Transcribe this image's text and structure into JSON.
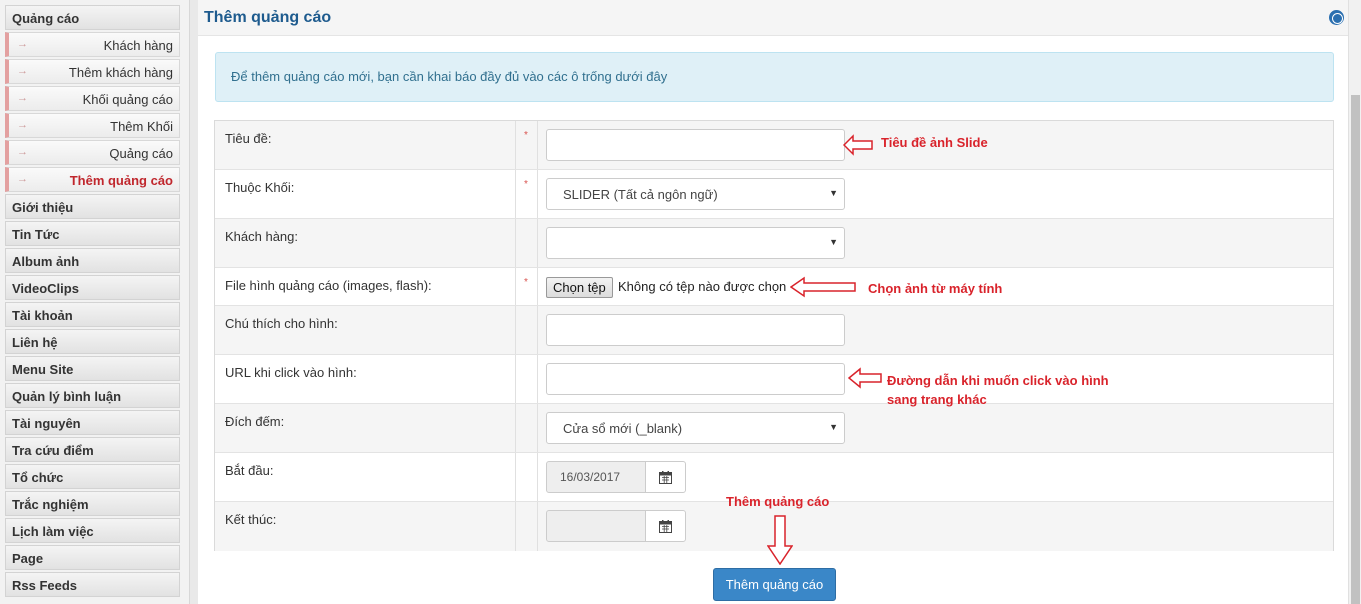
{
  "sidebar": {
    "top_item": "Quảng cáo",
    "sub_items": [
      {
        "label": "Khách hàng",
        "active": false
      },
      {
        "label": "Thêm khách hàng",
        "active": false
      },
      {
        "label": "Khối quảng cáo",
        "active": false
      },
      {
        "label": "Thêm Khối",
        "active": false
      },
      {
        "label": "Quảng cáo",
        "active": false
      },
      {
        "label": "Thêm quảng cáo",
        "active": true
      }
    ],
    "items": [
      "Giới thiệu",
      "Tin Tức",
      "Album ảnh",
      "VideoClips",
      "Tài khoản",
      "Liên hệ",
      "Menu Site",
      "Quản lý bình luận",
      "Tài nguyên",
      "Tra cứu điểm",
      "Tổ chức",
      "Trắc nghiệm",
      "Lịch làm việc",
      "Page",
      "Rss Feeds"
    ]
  },
  "header": {
    "title": "Thêm quảng cáo"
  },
  "info": "Để thêm quảng cáo mới, bạn cần khai báo đầy đủ vào các ô trống dưới đây",
  "form": {
    "title_label": "Tiêu đề:",
    "title_value": "",
    "block_label": "Thuộc Khối:",
    "block_value": "SLIDER (Tất cả ngôn ngữ)",
    "client_label": "Khách hàng:",
    "client_value": "",
    "file_label": "File hình quảng cáo (images, flash):",
    "file_button": "Chọn tệp",
    "file_status": "Không có tệp nào được chọn",
    "caption_label": "Chú thích cho hình:",
    "caption_value": "",
    "url_label": "URL khi click vào hình:",
    "url_value": "",
    "target_label": "Đích đếm:",
    "target_value": "Cửa sổ mới (_blank)",
    "start_label": "Bắt đầu:",
    "start_value": "16/03/2017",
    "end_label": "Kết thúc:",
    "end_value": "",
    "required_mark": "*"
  },
  "annotations": {
    "title_note": "Tiêu đề ảnh Slide",
    "file_note": "Chọn ảnh từ máy tính",
    "url_note_line1": "Đường dẫn khi muốn click vào hình",
    "url_note_line2": "sang trang khác",
    "submit_note": "Thêm quảng cáo"
  },
  "submit_label": "Thêm quảng cáo",
  "colors": {
    "accent": "#3a87c8",
    "title": "#1e5b8e",
    "annotation": "#d9232b",
    "active_menu": "#c0272d"
  }
}
